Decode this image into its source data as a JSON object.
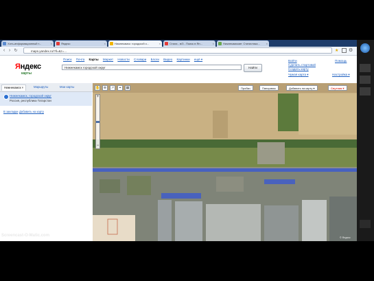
{
  "browser": {
    "tabs": [
      {
        "label": "Хоть-информационный т...",
        "active": false
      },
      {
        "label": "Яндекс",
        "active": false
      },
      {
        "label": "Нижнекамск: городской о...",
        "active": true
      },
      {
        "label": "Стала - в/3 - Поиск в Ян...",
        "active": false
      },
      {
        "label": "Нижнекамские: Статистика...",
        "active": false
      }
    ],
    "close_glyph": "×",
    "nav": {
      "back": "‹",
      "forward": "›",
      "reload": "↻",
      "home": "⌂"
    },
    "address": "maps.yandex.ru/?ll=&z=..."
  },
  "header": {
    "logo_first": "Я",
    "logo_rest": "ндекс",
    "logo_sub": "карты",
    "services": [
      {
        "label": "Поиск",
        "current": false
      },
      {
        "label": "Почта",
        "current": false
      },
      {
        "label": "Карты",
        "current": true
      },
      {
        "label": "Маркет",
        "current": false
      },
      {
        "label": "Новости",
        "current": false
      },
      {
        "label": "Словари",
        "current": false
      },
      {
        "label": "Блоги",
        "current": false
      },
      {
        "label": "Видео",
        "current": false
      },
      {
        "label": "Картинки",
        "current": false
      },
      {
        "label": "ещё ▾",
        "current": false
      }
    ],
    "search_value": "Нижнекамск городской округ",
    "search_button": "Найти",
    "right_links": {
      "link1": "Войти",
      "link2": "Помощь",
      "link3": "Сделать стартовой",
      "link4": "Создать карту",
      "link5": "Чужая карта ▾",
      "link6": "Настройка ▾"
    }
  },
  "left_panel": {
    "tabs": [
      "Нижнекамск ×",
      "Маршруты",
      "Мои карты"
    ],
    "result_title": "Нижнекамск, городской округ",
    "result_subtitle": "Россия, республика Татарстан",
    "action_1": "В закладки",
    "action_2": "Добавить на карту"
  },
  "map": {
    "tools": [
      "✋",
      "⊕",
      "↗",
      "⌖",
      "▦"
    ],
    "mode_buttons": {
      "traffic": "Пробки",
      "panorama": "Панорамы",
      "add": "Добавить на карту ▾",
      "layer": "Спутник ▾"
    },
    "zoom_plus": "+",
    "zoom_minus": "−",
    "copyright": "© Яндекс"
  },
  "watermark": "Screencast-O-Matic.com",
  "colors": {
    "tab_bar": "#1d3c6a",
    "road": "#3f5cc9",
    "field": "#c9b183",
    "forest": "#496a36",
    "layer_button": "#e03c28"
  }
}
